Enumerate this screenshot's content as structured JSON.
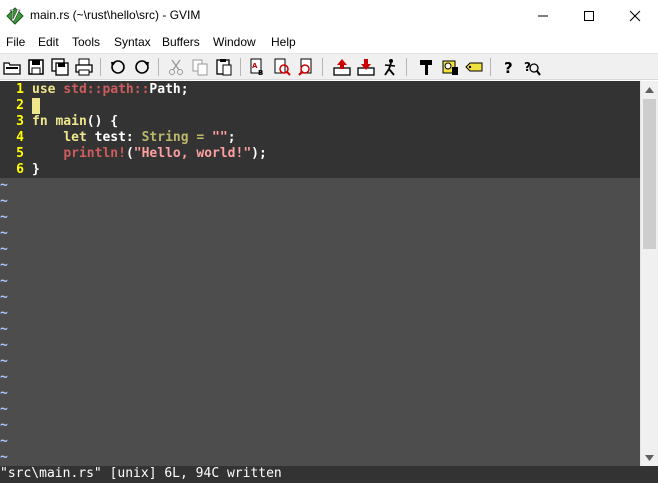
{
  "window": {
    "title": "main.rs (~\\rust\\hello\\src) - GVIM",
    "app_icon": "vim-icon",
    "controls": [
      "minimize-icon",
      "maximize-icon",
      "close-icon"
    ]
  },
  "menu": {
    "items": [
      "File",
      "Edit",
      "Tools",
      "Syntax",
      "Buffers",
      "Window",
      "Help"
    ]
  },
  "toolbar": {
    "icons": [
      "open-icon",
      "save-icon",
      "save-all-icon",
      "print-icon",
      "undo-icon",
      "redo-icon",
      "cut-icon",
      "copy-icon",
      "paste-icon",
      "find-replace-icon",
      "find-next-icon",
      "find-prev-icon",
      "load-session-icon",
      "save-session-icon",
      "run-script-icon",
      "make-icon",
      "shell-icon",
      "tag-icon",
      "help-icon",
      "find-help-icon"
    ]
  },
  "editor": {
    "lines": [
      {
        "num": "1",
        "parts": [
          {
            "t": "use",
            "c": "kw"
          },
          {
            "t": " ",
            "c": ""
          },
          {
            "t": "std",
            "c": "pathseg"
          },
          {
            "t": "::",
            "c": "pathseg"
          },
          {
            "t": "path",
            "c": "pathseg"
          },
          {
            "t": "::",
            "c": "pathseg"
          },
          {
            "t": "Path;",
            "c": ""
          }
        ]
      },
      {
        "num": "2",
        "parts": []
      },
      {
        "num": "3",
        "parts": [
          {
            "t": "fn",
            "c": "kw"
          },
          {
            "t": " ",
            "c": ""
          },
          {
            "t": "main",
            "c": "fnname"
          },
          {
            "t": "() {",
            "c": ""
          }
        ]
      },
      {
        "num": "4",
        "parts": [
          {
            "t": "    ",
            "c": ""
          },
          {
            "t": "let",
            "c": "kw"
          },
          {
            "t": " test: ",
            "c": ""
          },
          {
            "t": "String",
            "c": "typ"
          },
          {
            "t": " = ",
            "c": "typ"
          },
          {
            "t": "\"\"",
            "c": "str"
          },
          {
            "t": ";",
            "c": ""
          }
        ]
      },
      {
        "num": "5",
        "parts": [
          {
            "t": "    ",
            "c": ""
          },
          {
            "t": "println!",
            "c": "mac"
          },
          {
            "t": "(",
            "c": ""
          },
          {
            "t": "\"Hello, world!\"",
            "c": "str"
          },
          {
            "t": ");",
            "c": ""
          }
        ]
      },
      {
        "num": "6",
        "parts": [
          {
            "t": "}",
            "c": ""
          }
        ]
      }
    ],
    "tilde": "~",
    "tilde_count": 18
  },
  "cmdline": {
    "text": "\"src\\main.rs\" [unix] 6L, 94C written"
  },
  "colors": {
    "background": "#333333",
    "empty_area": "#4d4d4d",
    "line_number": "#ffff00",
    "keyword": "#f0e68c",
    "string": "#ffa0a0",
    "tilde": "#a9c9ff"
  }
}
